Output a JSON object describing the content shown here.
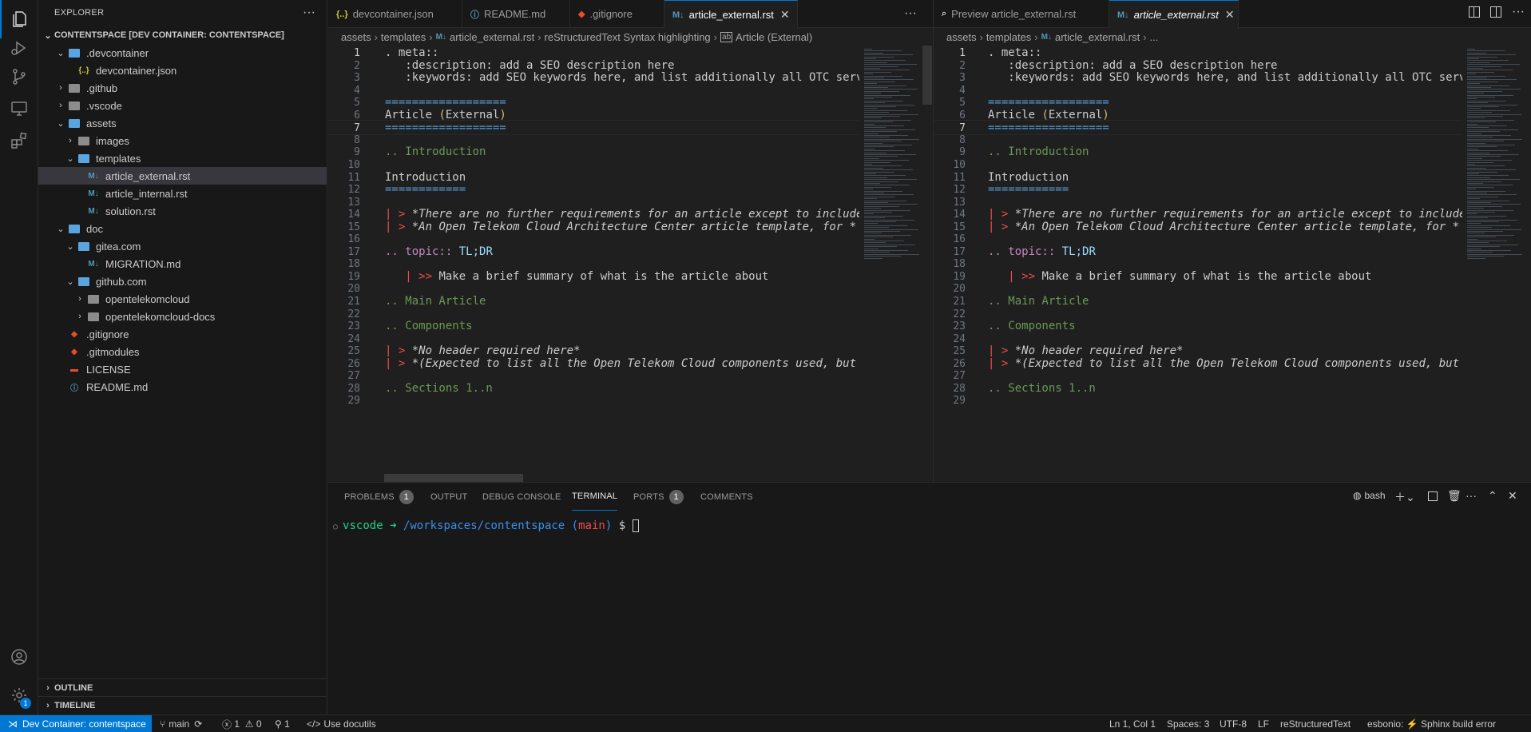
{
  "activity_bar": {
    "items": [
      "explorer-icon",
      "run-debug-icon",
      "source-control-icon",
      "remote-explorer-icon",
      "extensions-icon"
    ],
    "bottom": [
      "account-icon",
      "settings-gear-icon"
    ],
    "settings_badge": "1"
  },
  "explorer": {
    "title": "EXPLORER",
    "more": "···",
    "root": "CONTENTSPACE [DEV CONTAINER: CONTENTSPACE]",
    "items": [
      {
        "label": ".devcontainer",
        "kind": "folder-open"
      },
      {
        "label": "devcontainer.json",
        "kind": "json"
      },
      {
        "label": ".github",
        "kind": "folder"
      },
      {
        "label": ".vscode",
        "kind": "folder"
      },
      {
        "label": "assets",
        "kind": "folder-open"
      },
      {
        "label": "images",
        "kind": "folder"
      },
      {
        "label": "templates",
        "kind": "folder-open"
      },
      {
        "label": "article_external.rst",
        "kind": "rst"
      },
      {
        "label": "article_internal.rst",
        "kind": "rst"
      },
      {
        "label": "solution.rst",
        "kind": "rst"
      },
      {
        "label": "doc",
        "kind": "folder-open"
      },
      {
        "label": "gitea.com",
        "kind": "folder-open"
      },
      {
        "label": "MIGRATION.md",
        "kind": "md"
      },
      {
        "label": "github.com",
        "kind": "folder-open"
      },
      {
        "label": "opentelekomcloud",
        "kind": "folder"
      },
      {
        "label": "opentelekomcloud-docs",
        "kind": "folder"
      },
      {
        "label": ".gitignore",
        "kind": "git"
      },
      {
        "label": ".gitmodules",
        "kind": "git"
      },
      {
        "label": "LICENSE",
        "kind": "license"
      },
      {
        "label": "README.md",
        "kind": "info"
      }
    ],
    "outline": "OUTLINE",
    "timeline": "TIMELINE"
  },
  "left_editor": {
    "tabs": [
      {
        "icon": "{..}",
        "label": "devcontainer.json"
      },
      {
        "icon": "ⓘ",
        "label": "README.md"
      },
      {
        "icon": "◆",
        "label": ".gitignore"
      },
      {
        "icon": "M↓",
        "label": "article_external.rst",
        "close": "✕"
      }
    ],
    "more": "···",
    "breadcrumbs": [
      "assets",
      "templates",
      "article_external.rst",
      "reStructuredText Syntax highlighting",
      "Article (External)"
    ]
  },
  "right_editor": {
    "tabs": [
      {
        "icon": "⌕",
        "label": "Preview article_external.rst"
      },
      {
        "icon": "M↓",
        "label": "article_external.rst",
        "close": "✕"
      }
    ],
    "breadcrumbs": [
      "assets",
      "templates",
      "article_external.rst",
      "..."
    ]
  },
  "code_lines": [
    {
      "n": "1",
      "t": ". meta::"
    },
    {
      "n": "2",
      "t": "   :description: add a SEO description here"
    },
    {
      "n": "3",
      "t": "   :keywords: add SEO keywords here, and list additionally all OTC services used"
    },
    {
      "n": "4",
      "t": ""
    },
    {
      "n": "5",
      "t": "=================="
    },
    {
      "n": "6",
      "t": "Article (External)"
    },
    {
      "n": "7",
      "t": "=================="
    },
    {
      "n": "8",
      "t": ""
    },
    {
      "n": "9",
      "t": ".. Introduction"
    },
    {
      "n": "10",
      "t": ""
    },
    {
      "n": "11",
      "t": "Introduction"
    },
    {
      "n": "12",
      "t": "============"
    },
    {
      "n": "13",
      "t": ""
    },
    {
      "n": "14",
      "t": "| > *There are no further requirements for an article except to include"
    },
    {
      "n": "15",
      "t": "| > *An Open Telekom Cloud Architecture Center article template, for *"
    },
    {
      "n": "16",
      "t": ""
    },
    {
      "n": "17",
      "t": ".. topic:: TL;DR"
    },
    {
      "n": "18",
      "t": ""
    },
    {
      "n": "19",
      "t": "   | >> Make a brief summary of what is the article about"
    },
    {
      "n": "20",
      "t": ""
    },
    {
      "n": "21",
      "t": ".. Main Article"
    },
    {
      "n": "22",
      "t": ""
    },
    {
      "n": "23",
      "t": ".. Components"
    },
    {
      "n": "24",
      "t": ""
    },
    {
      "n": "25",
      "t": "| > *No header required here*"
    },
    {
      "n": "26",
      "t": "| > *(Expected to list all the Open Telekom Cloud components used, but"
    },
    {
      "n": "27",
      "t": ""
    },
    {
      "n": "28",
      "t": ".. Sections 1..n"
    },
    {
      "n": "29",
      "t": ""
    }
  ],
  "panel": {
    "tabs": [
      {
        "label": "PROBLEMS",
        "badge": "1"
      },
      {
        "label": "OUTPUT"
      },
      {
        "label": "DEBUG CONSOLE"
      },
      {
        "label": "TERMINAL"
      },
      {
        "label": "PORTS",
        "badge": "1"
      },
      {
        "label": "COMMENTS"
      }
    ],
    "shell": "bash",
    "terminal": {
      "user": "vscode",
      "arrow": "➜",
      "path": "/workspaces/contentspace",
      "branch": "main",
      "prompt": "$"
    }
  },
  "status_bar": {
    "remote": "Dev Container: contentspace",
    "branch": "main",
    "errors": "1",
    "warnings": "0",
    "ports": "1",
    "docutils": "Use docutils",
    "position": "Ln 1, Col 1",
    "spaces": "Spaces: 3",
    "encoding": "UTF-8",
    "eol": "LF",
    "language": "reStructuredText",
    "esbonio": "esbonio: ⚡ Sphinx build error"
  },
  "colors": {
    "accent": "#0078d4",
    "rst_icon": "#519aba",
    "git_icon": "#e44d26",
    "comment": "#6a9955",
    "heading": "#569cd6"
  }
}
